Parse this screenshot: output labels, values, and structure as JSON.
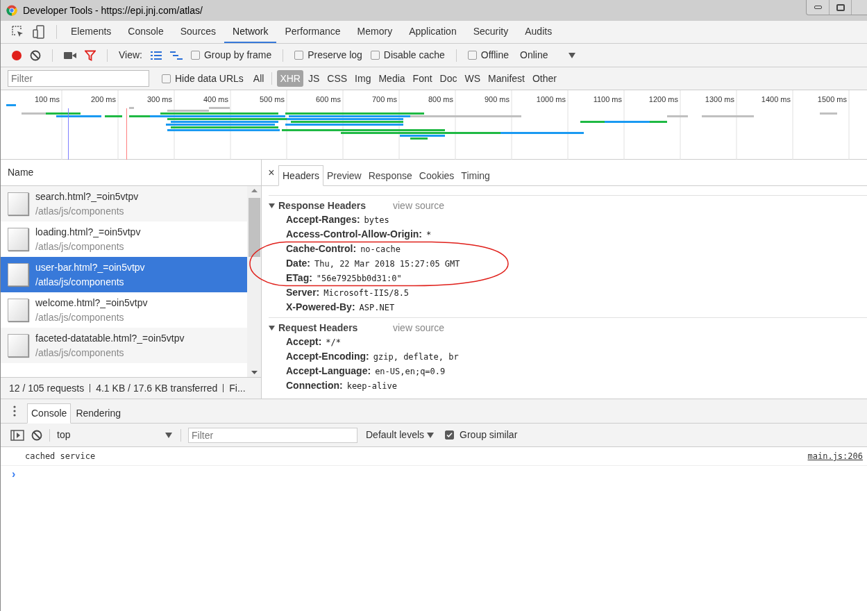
{
  "window": {
    "title": "Developer Tools - https://epi.jnj.com/atlas/"
  },
  "main_tabs": [
    {
      "label": "Elements",
      "selected": false
    },
    {
      "label": "Console",
      "selected": false
    },
    {
      "label": "Sources",
      "selected": false
    },
    {
      "label": "Network",
      "selected": true
    },
    {
      "label": "Performance",
      "selected": false
    },
    {
      "label": "Memory",
      "selected": false
    },
    {
      "label": "Application",
      "selected": false
    },
    {
      "label": "Security",
      "selected": false
    },
    {
      "label": "Audits",
      "selected": false
    }
  ],
  "toolbar": {
    "recording": true,
    "view_label": "View:",
    "group_by_frame": {
      "label": "Group by frame",
      "checked": false
    },
    "preserve_log": {
      "label": "Preserve log",
      "checked": false
    },
    "disable_cache": {
      "label": "Disable cache",
      "checked": false
    },
    "offline": {
      "label": "Offline",
      "checked": false
    },
    "throttling": "Online"
  },
  "filter_bar": {
    "placeholder": "Filter",
    "hide_data_urls": {
      "label": "Hide data URLs",
      "checked": false
    },
    "types": [
      {
        "label": "All",
        "selected": false
      },
      {
        "label": "XHR",
        "selected": true
      },
      {
        "label": "JS",
        "selected": false
      },
      {
        "label": "CSS",
        "selected": false
      },
      {
        "label": "Img",
        "selected": false
      },
      {
        "label": "Media",
        "selected": false
      },
      {
        "label": "Font",
        "selected": false
      },
      {
        "label": "Doc",
        "selected": false
      },
      {
        "label": "WS",
        "selected": false
      },
      {
        "label": "Manifest",
        "selected": false
      },
      {
        "label": "Other",
        "selected": false
      }
    ]
  },
  "overview": {
    "ticks": [
      "100 ms",
      "200 ms",
      "300 ms",
      "400 ms",
      "500 ms",
      "600 ms",
      "700 ms",
      "800 ms",
      "900 ms",
      "1000 ms",
      "1100 ms",
      "1200 ms",
      "1300 ms",
      "1400 ms",
      "1500 ms"
    ]
  },
  "requests": {
    "column": "Name",
    "rows": [
      {
        "name": "search.html?_=oin5vtpv",
        "path": "/atlas/js/components",
        "selected": false
      },
      {
        "name": "loading.html?_=oin5vtpv",
        "path": "/atlas/js/components",
        "selected": false
      },
      {
        "name": "user-bar.html?_=oin5vtpv",
        "path": "/atlas/js/components",
        "selected": true
      },
      {
        "name": "welcome.html?_=oin5vtpv",
        "path": "/atlas/js/components",
        "selected": false
      },
      {
        "name": "faceted-datatable.html?_=oin5vtpv",
        "path": "/atlas/js/components",
        "selected": false
      }
    ],
    "summary": [
      "12 / 105 requests",
      "4.1 KB / 17.6 KB transferred",
      "Fi..."
    ]
  },
  "details": {
    "close": "×",
    "tabs": [
      {
        "label": "Headers",
        "selected": true
      },
      {
        "label": "Preview",
        "selected": false
      },
      {
        "label": "Response",
        "selected": false
      },
      {
        "label": "Cookies",
        "selected": false
      },
      {
        "label": "Timing",
        "selected": false
      }
    ],
    "sections": [
      {
        "title": "Response Headers",
        "expanded": true,
        "link": "view source",
        "headers": [
          {
            "name": "Accept-Ranges:",
            "value": "bytes"
          },
          {
            "name": "Access-Control-Allow-Origin:",
            "value": "*"
          },
          {
            "name": "Cache-Control:",
            "value": "no-cache"
          },
          {
            "name": "Date:",
            "value": "Thu, 22 Mar 2018 15:27:05 GMT"
          },
          {
            "name": "ETag:",
            "value": "\"56e7925bb0d31:0\""
          },
          {
            "name": "Server:",
            "value": "Microsoft-IIS/8.5"
          },
          {
            "name": "X-Powered-By:",
            "value": "ASP.NET"
          }
        ]
      },
      {
        "title": "Request Headers",
        "expanded": true,
        "link": "view source",
        "headers": [
          {
            "name": "Accept:",
            "value": "*/*"
          },
          {
            "name": "Accept-Encoding:",
            "value": "gzip, deflate, br"
          },
          {
            "name": "Accept-Language:",
            "value": "en-US,en;q=0.9"
          },
          {
            "name": "Connection:",
            "value": "keep-alive"
          }
        ]
      }
    ]
  },
  "drawer": {
    "tabs": [
      {
        "label": "Console",
        "selected": true
      },
      {
        "label": "Rendering",
        "selected": false
      }
    ],
    "context": "top",
    "filter_placeholder": "Filter",
    "levels": "Default levels",
    "group_similar": {
      "label": "Group similar",
      "checked": true
    },
    "messages": [
      {
        "text": "cached service",
        "source": "main.js:206"
      }
    ],
    "prompt": "›"
  }
}
